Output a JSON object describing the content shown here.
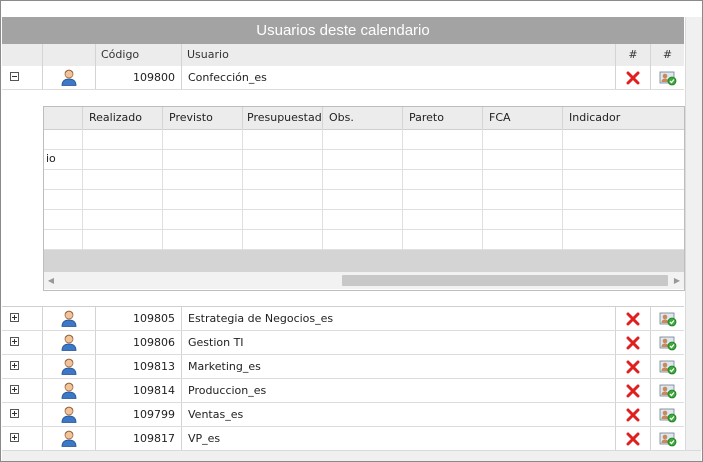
{
  "panel": {
    "title": "Usuarios deste calendario"
  },
  "grid": {
    "columns": {
      "code": "Código",
      "user": "Usuario",
      "delete": "#",
      "action": "#"
    },
    "expanded_row": {
      "code": "109800",
      "user": "Confección_es"
    },
    "rows": [
      {
        "code": "109805",
        "user": "Estrategia de Negocios_es"
      },
      {
        "code": "109806",
        "user": "Gestion TI"
      },
      {
        "code": "109813",
        "user": "Marketing_es"
      },
      {
        "code": "109814",
        "user": "Produccion_es"
      },
      {
        "code": "109799",
        "user": "Ventas_es"
      },
      {
        "code": "109817",
        "user": "VP_es"
      }
    ]
  },
  "detail": {
    "columns": [
      "",
      "Realizado",
      "Previsto",
      "Presupuestado",
      "Obs.",
      "Pareto",
      "FCA",
      "Indicador"
    ],
    "clipped_text": "io",
    "row_count": 6
  },
  "colors": {
    "title_bar": "#a3a3a3",
    "delete_icon": "#e02020",
    "header_bg": "#ececec"
  },
  "icons": {
    "user": "user-icon",
    "delete": "delete-x-icon",
    "action": "user-assign-icon"
  }
}
